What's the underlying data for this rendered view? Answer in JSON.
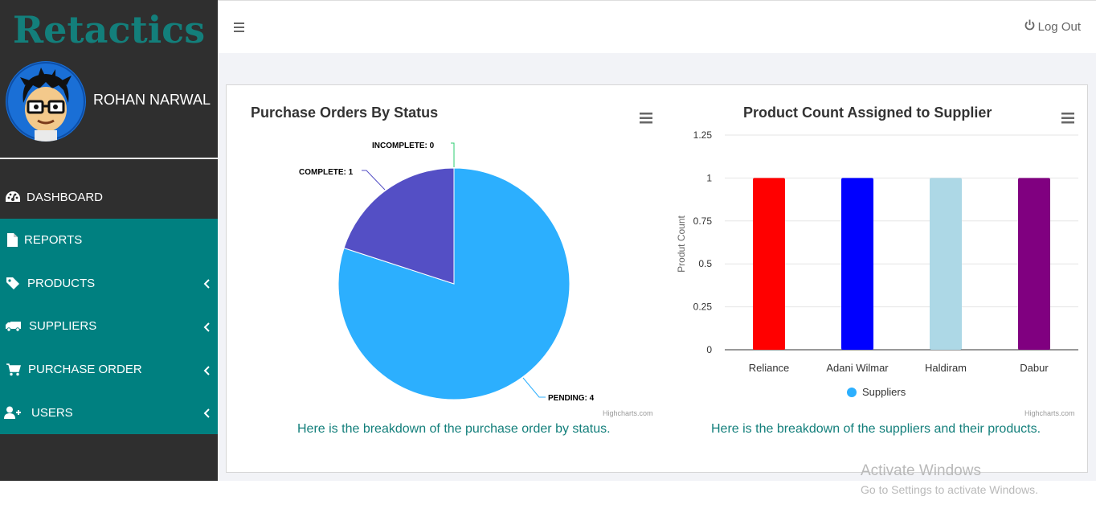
{
  "brand": {
    "name": "Retactics"
  },
  "user": {
    "name": "ROHAN NARWAL"
  },
  "nav": {
    "items": [
      {
        "label": "DASHBOARD",
        "icon": "dashboard-icon",
        "expandable": false
      },
      {
        "label": "REPORTS",
        "icon": "file-icon",
        "expandable": false
      },
      {
        "label": "PRODUCTS",
        "icon": "tag-icon",
        "expandable": true
      },
      {
        "label": "SUPPLIERS",
        "icon": "truck-icon",
        "expandable": true
      },
      {
        "label": "PURCHASE ORDER",
        "icon": "cart-icon",
        "expandable": true
      },
      {
        "label": "USERS",
        "icon": "user-plus-icon",
        "expandable": true
      }
    ]
  },
  "topbar": {
    "logout_label": "Log Out"
  },
  "colors": {
    "teal": "#008080",
    "brand": "#137f7b",
    "sidebar": "#2f2f2f"
  },
  "charts": {
    "pie": {
      "title": "Purchase Orders By Status",
      "caption": "Here is the breakdown of the purchase order by status.",
      "credits": "Highcharts.com"
    },
    "bar": {
      "title": "Product Count Assigned to Supplier",
      "caption": "Here is the breakdown of the suppliers and their products.",
      "credits": "Highcharts.com"
    }
  },
  "chart_data": [
    {
      "type": "pie",
      "title": "Purchase Orders By Status",
      "slices": [
        {
          "label": "INCOMPLETE",
          "value": 0,
          "color": "#2ecc71"
        },
        {
          "label": "PENDING",
          "value": 4,
          "color": "#2caffe"
        },
        {
          "label": "COMPLETE",
          "value": 1,
          "color": "#544fc5"
        }
      ],
      "data_labels": [
        "INCOMPLETE: 0",
        "COMPLETE: 1",
        "PENDING: 4"
      ]
    },
    {
      "type": "bar",
      "title": "Product Count Assigned to Supplier",
      "categories": [
        "Reliance",
        "Adani Wilmar",
        "Haldiram",
        "Dabur"
      ],
      "series": [
        {
          "name": "Suppliers",
          "values": [
            1,
            1,
            1,
            1
          ],
          "color": "#2caffe"
        }
      ],
      "bar_colors": [
        "#ff0000",
        "#0000ff",
        "#add8e6",
        "#800080"
      ],
      "ylabel": "Produt Count",
      "ylim": [
        0,
        1.25
      ],
      "yticks": [
        "0",
        "0.25",
        "0.5",
        "0.75",
        "1",
        "1.25"
      ],
      "grid": true,
      "legend": "bottom-center"
    }
  ],
  "watermark": {
    "line1": "Activate Windows",
    "line2": "Go to Settings to activate Windows."
  }
}
